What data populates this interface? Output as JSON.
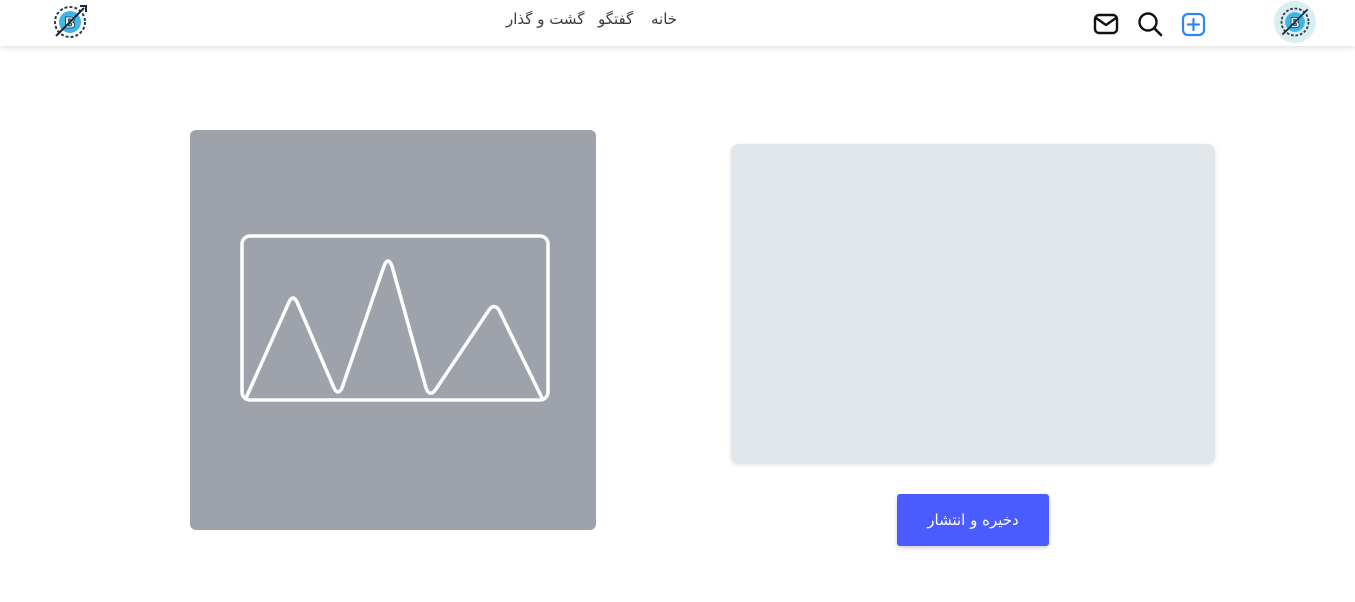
{
  "header": {
    "nav": {
      "home": "خانه",
      "chat": "گفتگو",
      "tour": "گشت و گذار"
    },
    "icons": {
      "logo_left": "brand-logo-icon",
      "logo_right": "brand-logo-icon",
      "mail": "mail-icon",
      "search": "search-icon",
      "add": "add-post-icon"
    },
    "accent_color": "#2f86f6"
  },
  "main": {
    "image_placeholder_icon": "image-placeholder-icon",
    "publish_button": "دخیره و انتشار",
    "publish_button_color": "#4a5cff"
  }
}
